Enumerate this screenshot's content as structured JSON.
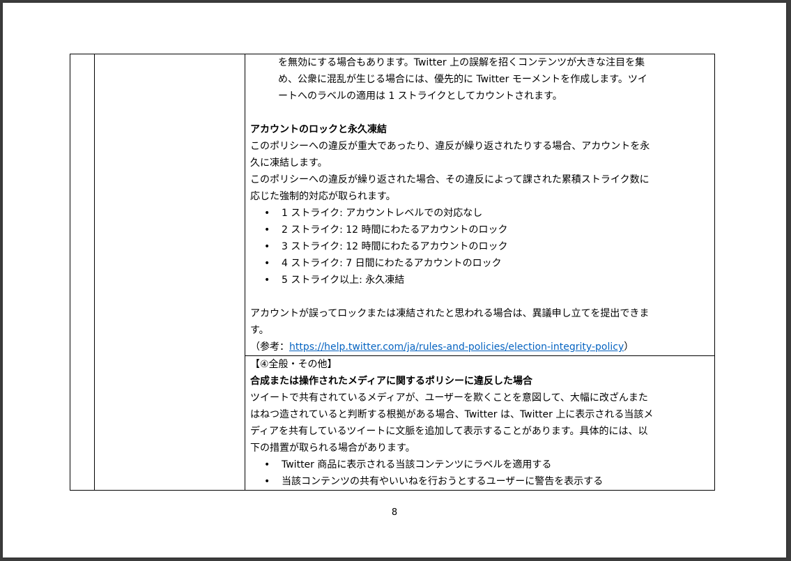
{
  "row1": {
    "cont_lines": [
      "を無効にする場合もあります。Twitter 上の誤解を招くコンテンツが大きな注目を集",
      "め、公衆に混乱が生じる場合には、優先的に Twitter モーメントを作成します。ツイ",
      "ートへのラベルの適用は 1 ストライクとしてカウントされます。"
    ],
    "heading": "アカウントのロックと永久凍結",
    "para1": [
      "このポリシーへの違反が重大であったり、違反が繰り返されたりする場合、アカウントを永",
      "久に凍結します。"
    ],
    "para2": [
      "このポリシーへの違反が繰り返された場合、その違反によって課された累積ストライク数に",
      "応じた強制的対応が取られます。"
    ],
    "bullets": [
      "1 ストライク: アカウントレベルでの対応なし",
      "2 ストライク: 12 時間にわたるアカウントのロック",
      "3 ストライク: 12 時間にわたるアカウントのロック",
      "4 ストライク: 7 日間にわたるアカウントのロック",
      "5 ストライク以上: 永久凍結"
    ],
    "para3": [
      "アカウントが誤ってロックまたは凍結されたと思われる場合は、異議申し立てを提出できま",
      "す。"
    ],
    "ref_prefix": "（参考：",
    "ref_url": "https://help.twitter.com/ja/rules-and-policies/election-integrity-policy",
    "ref_suffix": "）"
  },
  "row2": {
    "section_label": "【④全般・その他】",
    "heading": "合成または操作されたメディアに関するポリシーに違反した場合",
    "para": [
      "ツイートで共有されているメディアが、ユーザーを欺くことを意図して、大幅に改ざんまた",
      "はねつ造されていると判断する根拠がある場合、Twitter は、Twitter 上に表示される当該メ",
      "ディアを共有しているツイートに文脈を追加して表示することがあります。具体的には、以",
      "下の措置が取られる場合があります。"
    ],
    "bullets": [
      "Twitter 商品に表示される当該コンテンツにラベルを適用する",
      "当該コンテンツの共有やいいねを行おうとするユーザーに警告を表示する"
    ]
  },
  "page_number": "8"
}
